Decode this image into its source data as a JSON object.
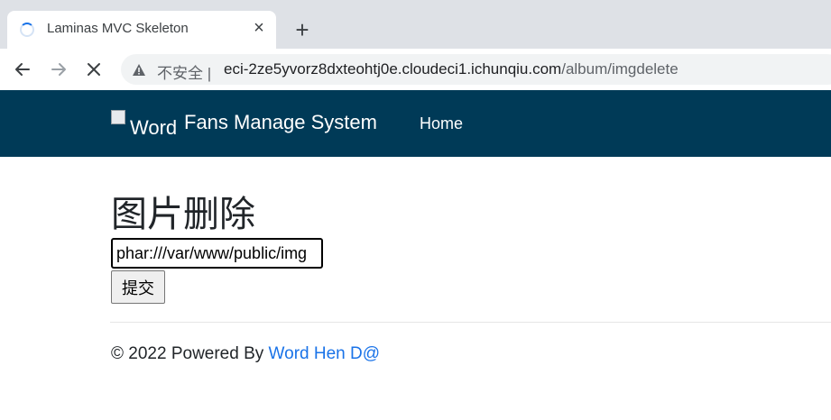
{
  "browser": {
    "tab_title": "Laminas MVC Skeleton",
    "tab_close_icon": "close-icon",
    "new_tab_icon": "plus-icon",
    "insecure_label": "不安全",
    "url_host": "eci-2ze5yvorz8dxteohtj0e.cloudeci1.ichunqiu.com",
    "url_path": "/album/imgdelete"
  },
  "navbar": {
    "brand_alt": "Word",
    "brand_text": "Fans Manage System",
    "home_label": "Home",
    "background": "#003a57"
  },
  "main": {
    "title": "图片删除",
    "input_value": "phar:///var/www/public/img",
    "submit_label": "提交"
  },
  "footer": {
    "prefix": "© 2022 Powered By ",
    "link_text": "Word Hen D@",
    "link_color": "#1a73e8"
  }
}
